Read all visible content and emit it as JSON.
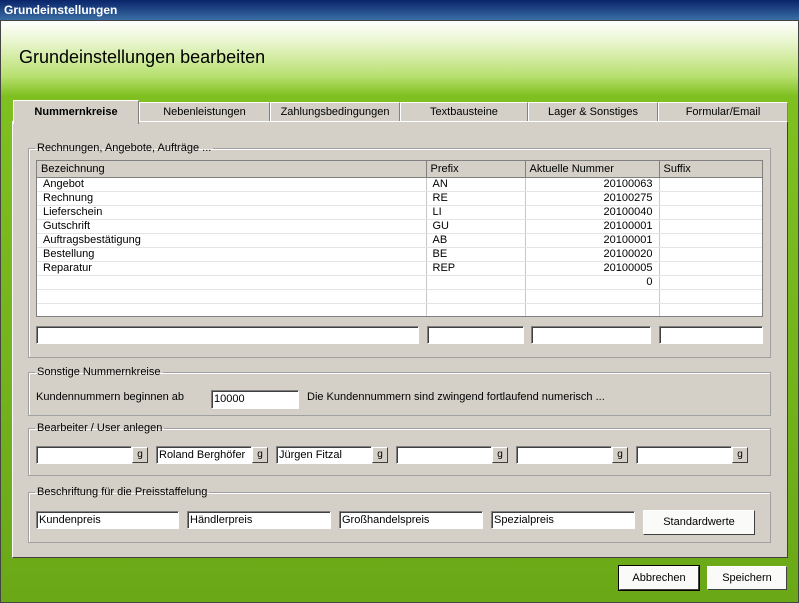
{
  "window": {
    "title": "Grundeinstellungen"
  },
  "heading": "Grundeinstellungen bearbeiten",
  "tabs": [
    "Nummernkreise",
    "Nebenleistungen",
    "Zahlungsbedingungen",
    "Textbausteine",
    "Lager & Sonstiges",
    "Formular/Email"
  ],
  "group_numbers": {
    "legend": "Rechnungen, Angebote, Aufträge ...",
    "columns": [
      "Bezeichnung",
      "Prefix",
      "Aktuelle Nummer",
      "Suffix"
    ],
    "rows": [
      [
        "Angebot",
        "AN",
        "20100063",
        ""
      ],
      [
        "Rechnung",
        "RE",
        "20100275",
        ""
      ],
      [
        "Lieferschein",
        "LI",
        "20100040",
        ""
      ],
      [
        "Gutschrift",
        "GU",
        "20100001",
        ""
      ],
      [
        "Auftragsbestätigung",
        "AB",
        "20100001",
        ""
      ],
      [
        "Bestellung",
        "BE",
        "20100020",
        ""
      ],
      [
        "Reparatur",
        "REP",
        "20100005",
        ""
      ],
      [
        "",
        "",
        "0",
        ""
      ]
    ]
  },
  "group_other": {
    "legend": "Sonstige Nummernkreise",
    "label": "Kundennummern beginnen ab",
    "value": "10000",
    "note": "Die Kundennummern sind zwingend fortlaufend numerisch ..."
  },
  "group_users": {
    "legend": "Bearbeiter / User anlegen",
    "users": [
      "",
      "Roland Berghöfer",
      "Jürgen Fitzal",
      "",
      "",
      ""
    ],
    "button_label": "g"
  },
  "group_prices": {
    "legend": "Beschriftung für die Preisstaffelung",
    "labels": [
      "Kundenpreis",
      "Händlerpreis",
      "Großhandelspreis",
      "Spezialpreis"
    ],
    "default_button": "Standardwerte"
  },
  "footer": {
    "cancel": "Abbrechen",
    "save": "Speichern"
  }
}
